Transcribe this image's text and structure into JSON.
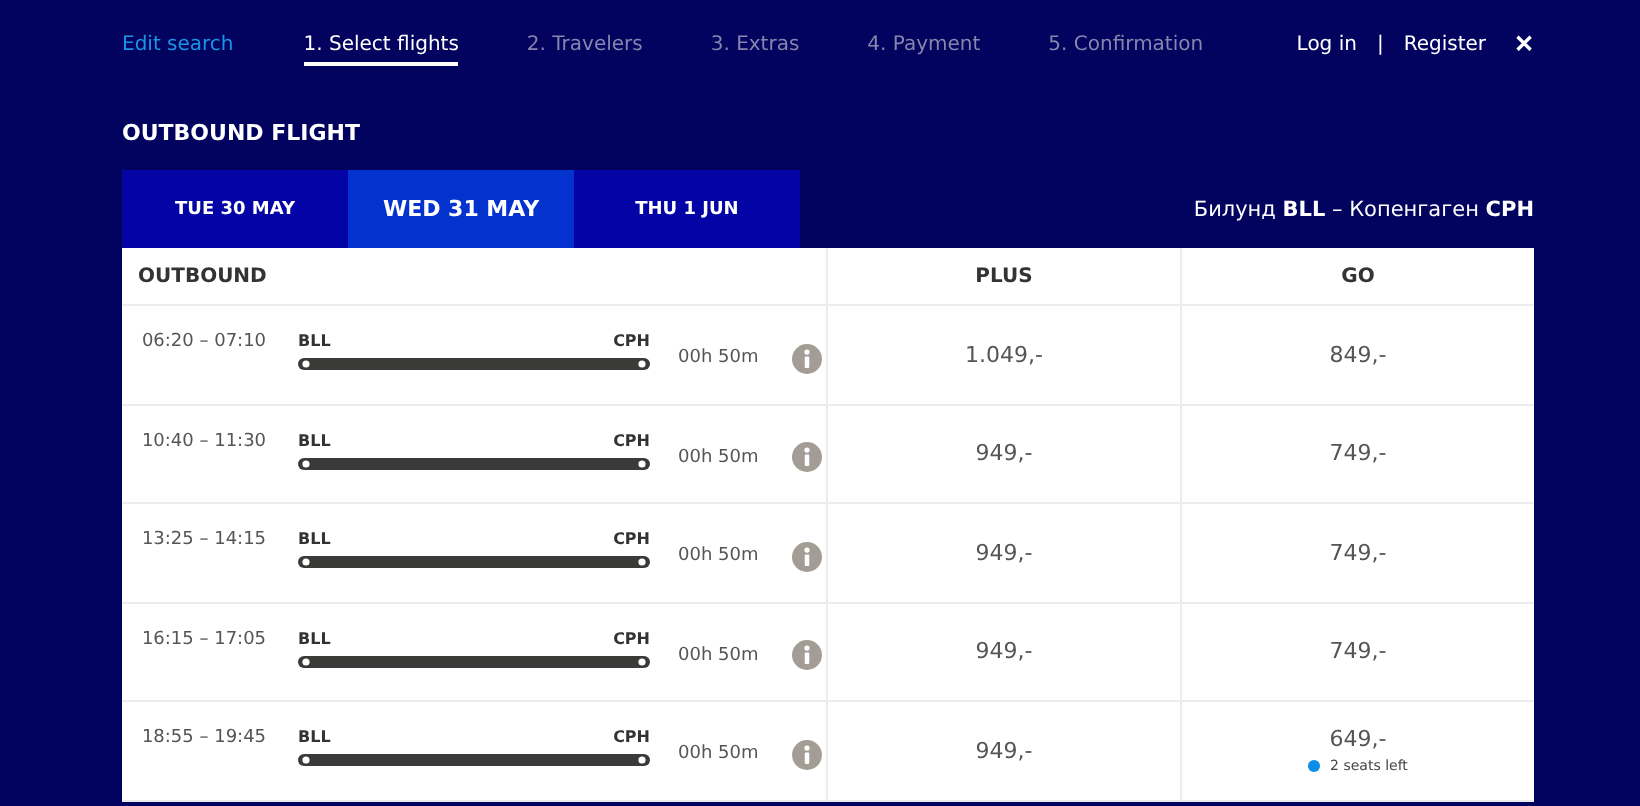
{
  "nav": {
    "edit_search": "Edit search",
    "steps": [
      {
        "label": "1. Select flights",
        "selected": true
      },
      {
        "label": "2. Travelers",
        "selected": false
      },
      {
        "label": "3. Extras",
        "selected": false
      },
      {
        "label": "4. Payment",
        "selected": false
      },
      {
        "label": "5. Confirmation",
        "selected": false
      }
    ],
    "login": "Log in",
    "separator": "|",
    "register": "Register",
    "close": "✕"
  },
  "section_title": "OUTBOUND FLIGHT",
  "date_tabs": [
    {
      "label": "TUE 30 MAY",
      "selected": false
    },
    {
      "label": "WED 31 MAY",
      "selected": true
    },
    {
      "label": "THU 1 JUN",
      "selected": false
    }
  ],
  "route": "Билунд **BLL** – Копенгаген **CPH**",
  "table": {
    "columns": [
      "OUTBOUND",
      "PLUS",
      "GO"
    ],
    "rows": [
      {
        "time": "06:20 – 07:10",
        "from": "BLL",
        "to": "CPH",
        "duration": "00h 50m",
        "plus": "1.049,-",
        "go": "849,-"
      },
      {
        "time": "10:40 – 11:30",
        "from": "BLL",
        "to": "CPH",
        "duration": "00h 50m",
        "plus": "949,-",
        "go": "749,-"
      },
      {
        "time": "13:25 – 14:15",
        "from": "BLL",
        "to": "CPH",
        "duration": "00h 50m",
        "plus": "949,-",
        "go": "749,-"
      },
      {
        "time": "16:15 – 17:05",
        "from": "BLL",
        "to": "CPH",
        "duration": "00h 50m",
        "plus": "949,-",
        "go": "749,-"
      },
      {
        "time": "18:55 – 19:45",
        "from": "BLL",
        "to": "CPH",
        "duration": "00h 50m",
        "plus": "949,-",
        "go": "649,-",
        "go_note": "2 seats left"
      }
    ]
  }
}
